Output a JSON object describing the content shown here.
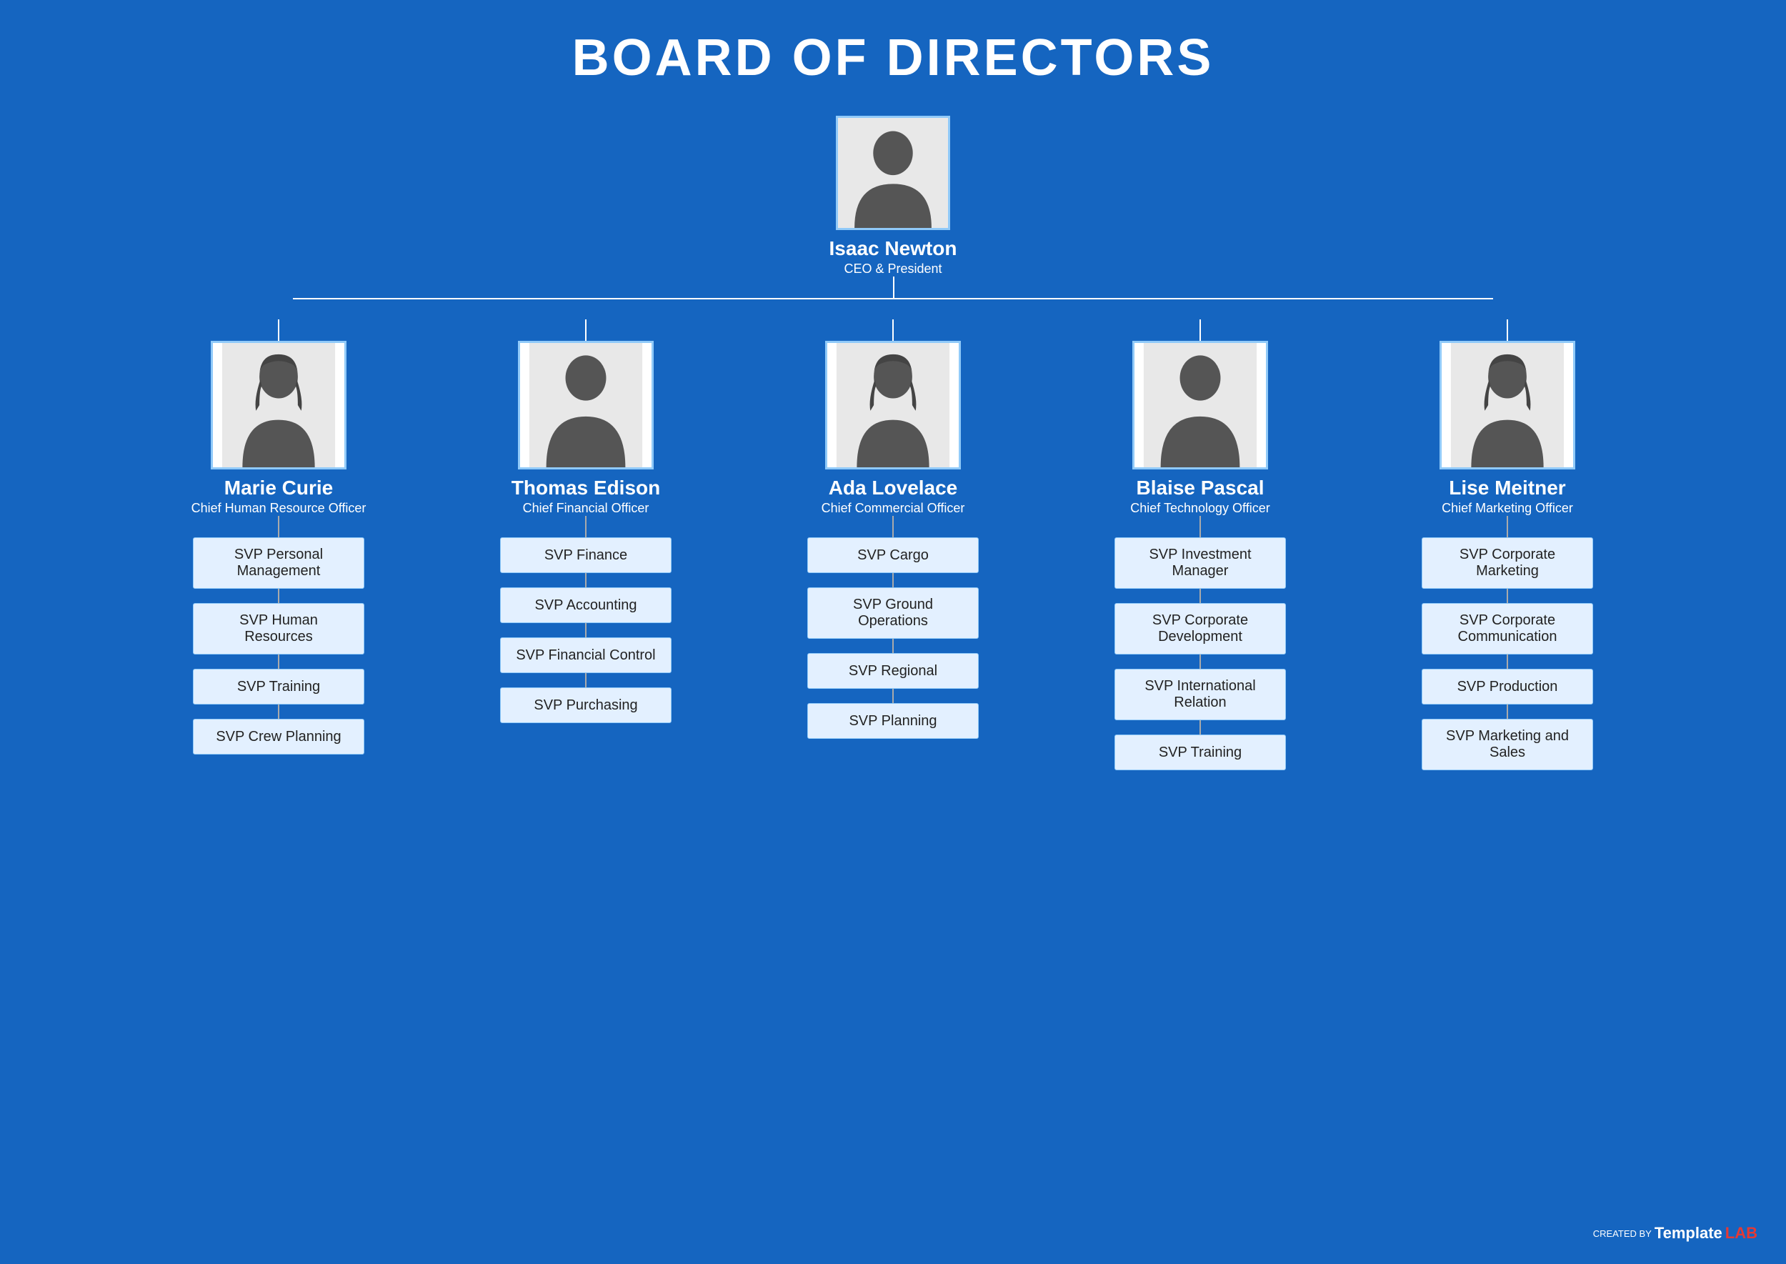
{
  "title": "BOARD OF DIRECTORS",
  "ceo": {
    "name": "Isaac Newton",
    "role": "CEO & President"
  },
  "directors": [
    {
      "name": "Marie Curie",
      "role": "Chief Human Resource Officer",
      "gender": "female",
      "svps": [
        "SVP Personal Management",
        "SVP Human Resources",
        "SVP Training",
        "SVP Crew Planning"
      ]
    },
    {
      "name": "Thomas Edison",
      "role": "Chief Financial Officer",
      "gender": "male",
      "svps": [
        "SVP Finance",
        "SVP Accounting",
        "SVP Financial Control",
        "SVP Purchasing"
      ]
    },
    {
      "name": "Ada Lovelace",
      "role": "Chief Commercial Officer",
      "gender": "female",
      "svps": [
        "SVP Cargo",
        "SVP Ground Operations",
        "SVP Regional",
        "SVP Planning"
      ]
    },
    {
      "name": "Blaise Pascal",
      "role": "Chief Technology Officer",
      "gender": "male",
      "svps": [
        "SVP Investment Manager",
        "SVP Corporate Development",
        "SVP International Relation",
        "SVP Training"
      ]
    },
    {
      "name": "Lise Meitner",
      "role": "Chief Marketing Officer",
      "gender": "female",
      "svps": [
        "SVP Corporate Marketing",
        "SVP Corporate Communication",
        "SVP Production",
        "SVP Marketing and Sales"
      ]
    }
  ],
  "watermark": {
    "created_by": "CREATED BY",
    "template": "Template",
    "lab": "LAB"
  }
}
